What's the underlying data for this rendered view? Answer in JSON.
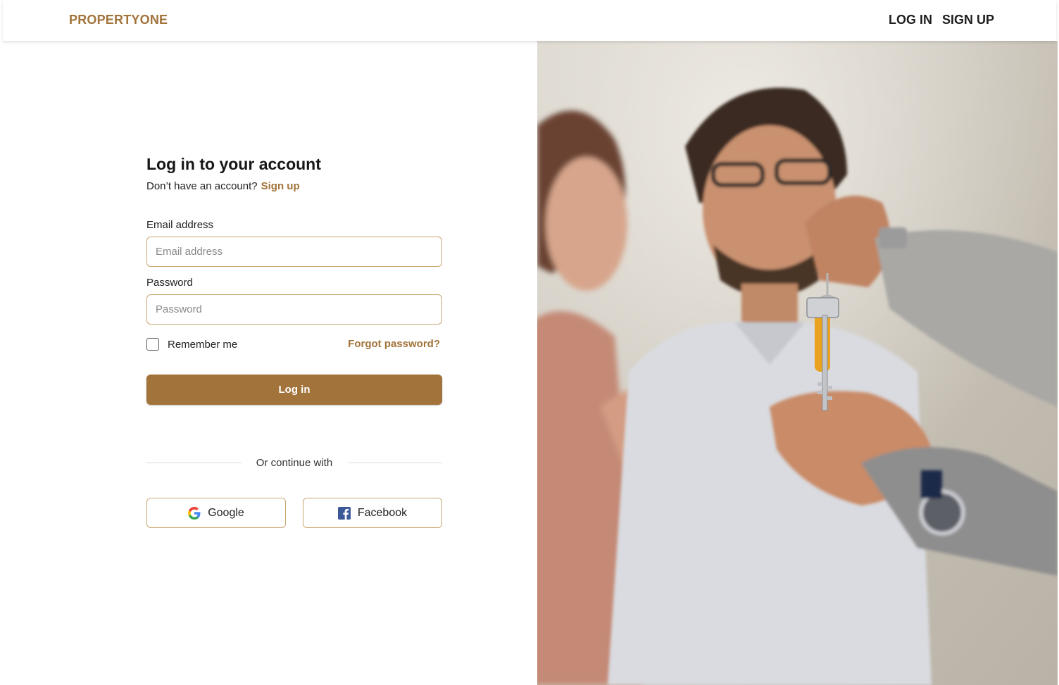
{
  "nav": {
    "brand": "PROPERTYONE",
    "login": "LOG IN",
    "signup": "SIGN UP"
  },
  "form": {
    "title": "Log in to your account",
    "subtitle_text": "Don’t have an account?",
    "subtitle_link": "Sign up",
    "email_label": "Email address",
    "email_placeholder": "Email address",
    "email_value": "",
    "password_label": "Password",
    "password_placeholder": "Password",
    "password_value": "",
    "remember_label": "Remember me",
    "remember_checked": false,
    "forgot": "Forgot password?",
    "login_button": "Log in",
    "divider_text": "Or continue with",
    "google": "Google",
    "facebook": "Facebook"
  },
  "icons": {
    "google": "google-icon",
    "facebook": "facebook-icon",
    "checkbox": "checkbox-unchecked"
  },
  "colors": {
    "accent": "#a2733a",
    "input_border": "#c9a671",
    "facebook": "#3b5998"
  },
  "hero_image": {
    "subject": "couple receiving house keys"
  }
}
